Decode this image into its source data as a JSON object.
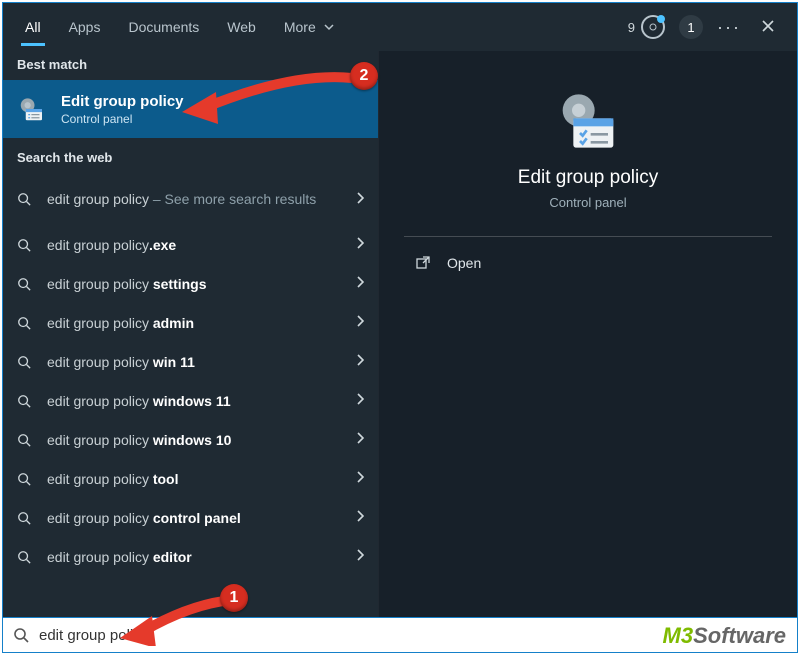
{
  "tabs": {
    "all": "All",
    "apps": "Apps",
    "documents": "Documents",
    "web": "Web",
    "more": "More"
  },
  "top_right": {
    "count": "9",
    "num": "1"
  },
  "sections": {
    "best_match": "Best match",
    "search_web": "Search the web"
  },
  "best": {
    "title": "Edit group policy",
    "subtitle": "Control panel"
  },
  "web_results": [
    {
      "prefix": "edit group policy",
      "suffix": "",
      "more": " – See more search results"
    },
    {
      "prefix": "edit group policy",
      "suffix": ".exe",
      "more": ""
    },
    {
      "prefix": "edit group policy ",
      "suffix": "settings",
      "more": ""
    },
    {
      "prefix": "edit group policy ",
      "suffix": "admin",
      "more": ""
    },
    {
      "prefix": "edit group policy ",
      "suffix": "win 11",
      "more": ""
    },
    {
      "prefix": "edit group policy ",
      "suffix": "windows 11",
      "more": ""
    },
    {
      "prefix": "edit group policy ",
      "suffix": "windows 10",
      "more": ""
    },
    {
      "prefix": "edit group policy ",
      "suffix": "tool",
      "more": ""
    },
    {
      "prefix": "edit group policy ",
      "suffix": "control panel",
      "more": ""
    },
    {
      "prefix": "edit group policy ",
      "suffix": "editor",
      "more": ""
    }
  ],
  "details": {
    "title": "Edit group policy",
    "subtitle": "Control panel",
    "open": "Open"
  },
  "search": {
    "query": "edit group policy"
  },
  "annotations": {
    "step1": "1",
    "step2": "2"
  },
  "watermark": {
    "m3": "M3",
    "software": "Software"
  }
}
